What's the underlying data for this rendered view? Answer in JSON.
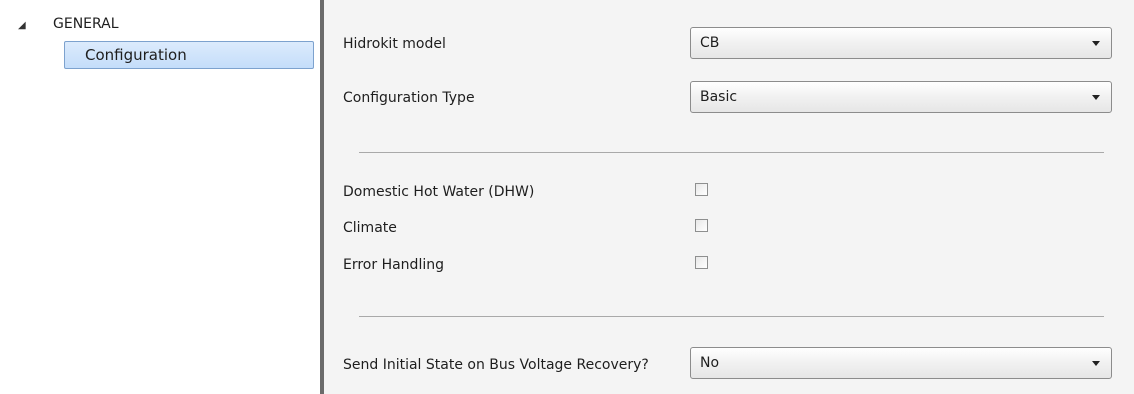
{
  "tree": {
    "root_label": "GENERAL",
    "selected_item": "Configuration"
  },
  "settings": {
    "hidrokit_model": {
      "label": "Hidrokit model",
      "value": "CB"
    },
    "configuration_type": {
      "label": "Configuration Type",
      "value": "Basic"
    },
    "checkboxes": [
      {
        "label": "Domestic Hot Water (DHW)",
        "checked": false
      },
      {
        "label": "Climate",
        "checked": false
      },
      {
        "label": "Error Handling",
        "checked": false
      }
    ],
    "send_initial_state": {
      "label": "Send Initial State on Bus Voltage Recovery?",
      "value": "No"
    }
  },
  "colors": {
    "selection_fill": "#c4ddfa",
    "selection_border": "#7da2ce",
    "panel_background": "#f4f4f4",
    "splitter": "#6b6b6b"
  },
  "icons": {
    "tree_expander": "expanded-triangle-icon",
    "dropdown_arrow": "chevron-down-icon"
  }
}
